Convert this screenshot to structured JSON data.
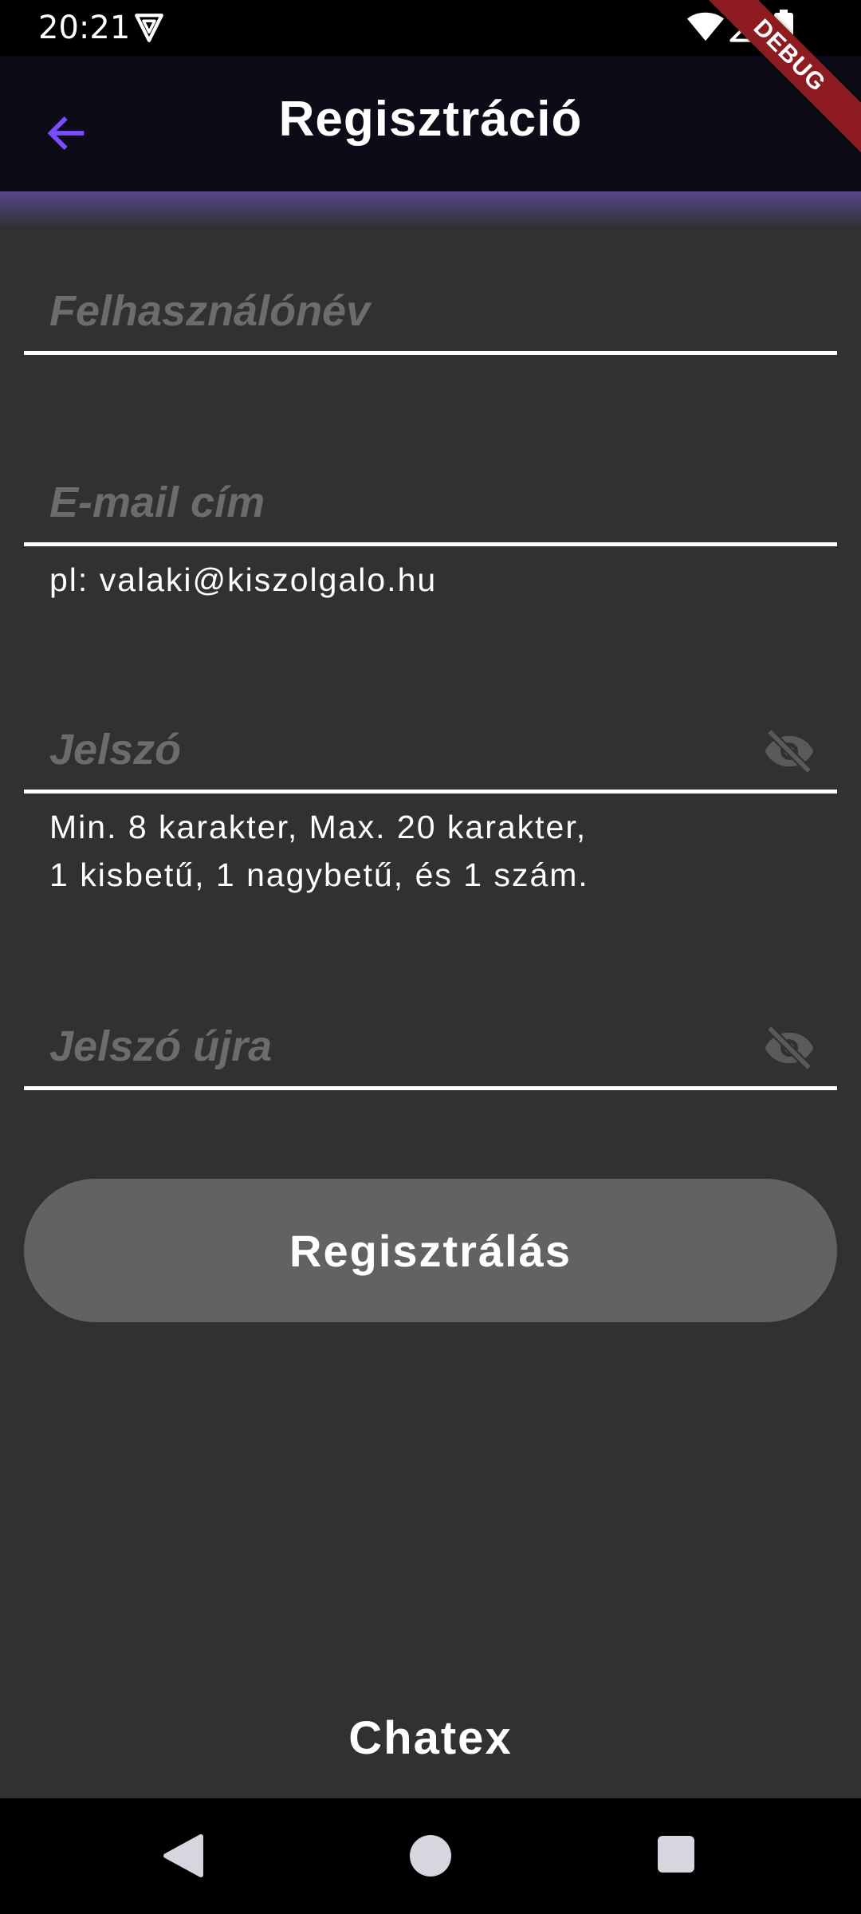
{
  "status_bar": {
    "time": "20:21",
    "icons": [
      "vpn-icon",
      "wifi-icon",
      "signal-icon",
      "battery-icon"
    ]
  },
  "debug_banner": "DEBUG",
  "app_bar": {
    "title": "Regisztráció",
    "back_icon": "arrow-back-icon"
  },
  "form": {
    "username": {
      "placeholder": "Felhasználónév",
      "value": ""
    },
    "email": {
      "placeholder": "E-mail cím",
      "value": "",
      "helper": "pl: valaki@kiszolgalo.hu"
    },
    "password": {
      "placeholder": "Jelszó",
      "value": "",
      "helper": "Min. 8 karakter, Max. 20 karakter,\n1 kisbetű, 1 nagybetű, és 1 szám.",
      "toggle_icon": "visibility-off-icon"
    },
    "password_confirm": {
      "placeholder": "Jelszó újra",
      "value": "",
      "toggle_icon": "visibility-off-icon"
    },
    "submit_label": "Regisztrálás"
  },
  "brand": "Chatex",
  "nav_bar": {
    "icons": [
      "nav-back-icon",
      "nav-home-icon",
      "nav-recents-icon"
    ]
  },
  "colors": {
    "background": "#313131",
    "app_bar": "#0d0b17",
    "accent": "#7c4dff",
    "button": "#626262",
    "debug_banner": "#8e1b20"
  }
}
